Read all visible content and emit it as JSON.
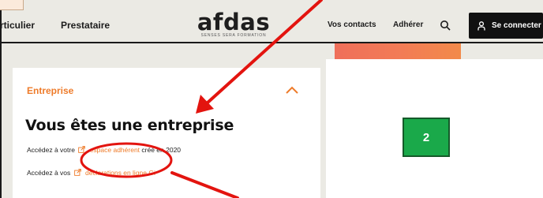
{
  "header": {
    "nav_left": [
      "rticulier",
      "Prestataire"
    ],
    "logo_word": "afdas",
    "logo_tagline": "SENSES SERA FORMATION",
    "nav_right": [
      "Vos contacts",
      "Adhérer"
    ],
    "connect_label": "Se connecter"
  },
  "card": {
    "section_label": "Entreprise",
    "title": "Vous êtes une entreprise",
    "line1": {
      "prefix": "Accédez à votre",
      "link": "espace adhérent",
      "suffix": "créé en 2020"
    },
    "line2": {
      "prefix": "Accédez à vos",
      "link": "déclarations en ligne Gi"
    }
  },
  "annotation": {
    "badge": "2"
  },
  "colors": {
    "accent_orange": "#ee7b2a",
    "annotation_red": "#e3140f",
    "badge_green": "#1aa94a"
  }
}
